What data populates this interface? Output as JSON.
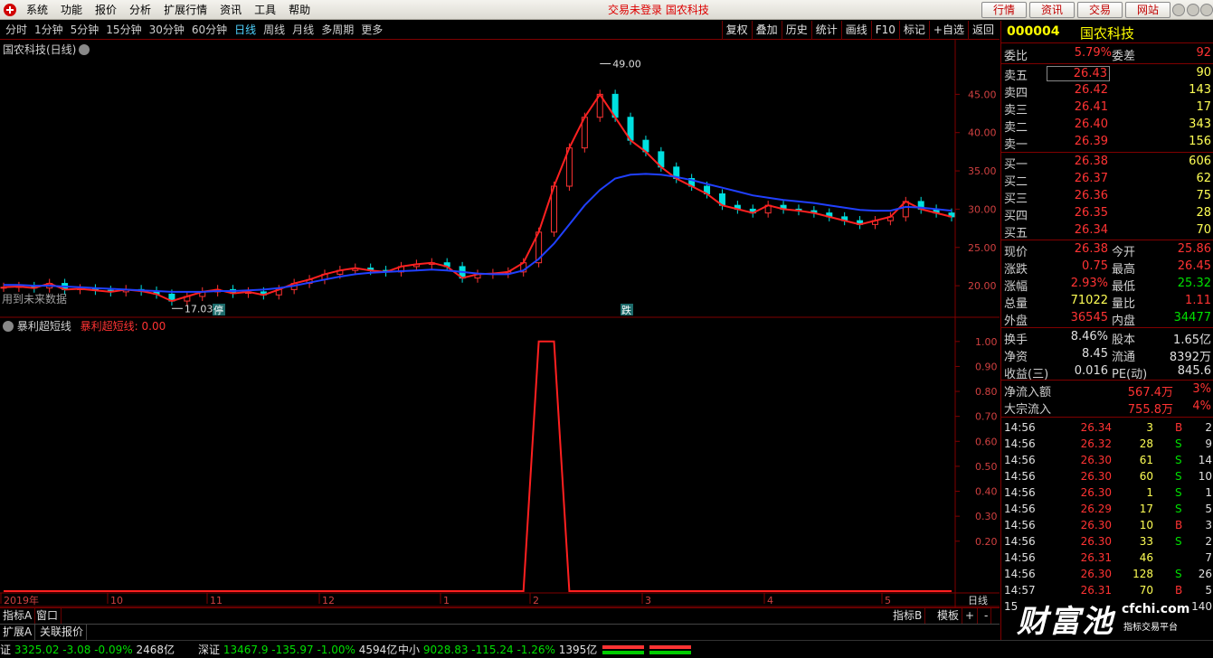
{
  "menubar": {
    "items": [
      "系统",
      "功能",
      "报价",
      "分析",
      "扩展行情",
      "资讯",
      "工具",
      "帮助"
    ],
    "status": "交易未登录  国农科技",
    "buttons": [
      "行情",
      "资讯",
      "交易",
      "网站"
    ]
  },
  "periodbar": {
    "periods": [
      "分时",
      "1分钟",
      "5分钟",
      "15分钟",
      "30分钟",
      "60分钟",
      "日线",
      "周线",
      "月线",
      "多周期",
      "更多"
    ],
    "active": "日线",
    "tools": [
      "复权",
      "叠加",
      "历史",
      "统计",
      "画线",
      "F10",
      "标记",
      "+自选",
      "返回"
    ]
  },
  "main_chart": {
    "title": "国农科技(日线)",
    "future_note": "用到未来数据",
    "high_label": "49.00",
    "low_label": "17.03",
    "marker_ting": "停",
    "marker_die": "跌"
  },
  "indicator": {
    "name": "暴利超短线",
    "value_label": "暴利超短线: 0.00"
  },
  "axis_bottom": {
    "labels": [
      "2019年",
      "10",
      "11",
      "12",
      "1",
      "2",
      "3",
      "4",
      "5"
    ],
    "period": "日线"
  },
  "tabs": {
    "row1": [
      "指标A",
      "窗口"
    ],
    "row1_right": [
      "指标B",
      "模板",
      "+",
      "-"
    ],
    "row2": [
      "扩展A",
      "关联报价"
    ]
  },
  "chart_data": [
    {
      "type": "line",
      "title": "国农科技(日线)",
      "ylim": [
        16,
        50
      ],
      "yticks": [
        "45.00",
        "40.00",
        "35.00",
        "30.00",
        "25.00",
        "20.00"
      ],
      "high": 49.0,
      "low": 17.03,
      "series": [
        {
          "values": [
            19.8,
            19.9,
            19.7,
            20.3,
            19.5,
            19.6,
            19.4,
            19.2,
            19.5,
            19.3,
            18.9,
            18.0,
            18.6,
            19.2,
            19.5,
            19.0,
            19.2,
            18.8,
            19.5,
            20.3,
            20.8,
            21.5,
            22.0,
            22.3,
            22.0,
            21.8,
            22.5,
            22.8,
            23.0,
            22.5,
            21.0,
            21.5,
            21.6,
            21.8,
            23.0,
            27.0,
            33.0,
            38.0,
            42.0,
            45.0,
            42.0,
            39.0,
            37.5,
            35.5,
            34.0,
            33.0,
            32.0,
            30.5,
            30.0,
            29.5,
            30.5,
            30.0,
            29.8,
            29.5,
            29.0,
            28.5,
            28.0,
            28.5,
            29.0,
            31.0,
            30.0,
            29.5,
            29.0
          ]
        },
        {
          "values": [
            20.1,
            20.1,
            20.0,
            20.0,
            19.9,
            19.8,
            19.7,
            19.6,
            19.5,
            19.4,
            19.3,
            19.2,
            19.2,
            19.2,
            19.3,
            19.3,
            19.4,
            19.5,
            19.7,
            20.0,
            20.4,
            20.8,
            21.2,
            21.5,
            21.7,
            21.8,
            21.9,
            22.0,
            22.1,
            22.0,
            21.8,
            21.6,
            21.5,
            21.5,
            22.0,
            23.5,
            25.5,
            28.0,
            30.5,
            32.5,
            34.0,
            34.5,
            34.6,
            34.5,
            34.2,
            33.8,
            33.3,
            32.8,
            32.3,
            31.8,
            31.5,
            31.2,
            31.0,
            30.8,
            30.5,
            30.2,
            29.9,
            29.8,
            29.8,
            30.3,
            30.2,
            30.0,
            29.8
          ]
        }
      ]
    },
    {
      "type": "line",
      "title": "暴利超短线",
      "ylim": [
        0,
        1.05
      ],
      "yticks": [
        "1.00",
        "0.90",
        "0.80",
        "0.70",
        "0.60",
        "0.50",
        "0.40",
        "0.30",
        "0.20"
      ],
      "series": [
        {
          "name": "暴利超短线",
          "values": [
            0,
            0,
            0,
            0,
            0,
            0,
            0,
            0,
            0,
            0,
            0,
            0,
            0,
            0,
            0,
            0,
            0,
            0,
            0,
            0,
            0,
            0,
            0,
            0,
            0,
            0,
            0,
            0,
            0,
            0,
            0,
            0,
            0,
            0,
            0,
            1,
            1,
            0,
            0,
            0,
            0,
            0,
            0,
            0,
            0,
            0,
            0,
            0,
            0,
            0,
            0,
            0,
            0,
            0,
            0,
            0,
            0,
            0,
            0,
            0,
            0,
            0,
            0
          ]
        }
      ]
    }
  ],
  "panel": {
    "code": "000004",
    "name": "国农科技",
    "weibi_label": "委比",
    "weibi": "5.79%",
    "weicha_label": "委差",
    "weicha": "92",
    "asks": [
      {
        "label": "卖五",
        "price": "26.43",
        "vol": "90"
      },
      {
        "label": "卖四",
        "price": "26.42",
        "vol": "143"
      },
      {
        "label": "卖三",
        "price": "26.41",
        "vol": "17"
      },
      {
        "label": "卖二",
        "price": "26.40",
        "vol": "343"
      },
      {
        "label": "卖一",
        "price": "26.39",
        "vol": "156"
      }
    ],
    "bids": [
      {
        "label": "买一",
        "price": "26.38",
        "vol": "606"
      },
      {
        "label": "买二",
        "price": "26.37",
        "vol": "62"
      },
      {
        "label": "买三",
        "price": "26.36",
        "vol": "75"
      },
      {
        "label": "买四",
        "price": "26.35",
        "vol": "28"
      },
      {
        "label": "买五",
        "price": "26.34",
        "vol": "70"
      }
    ],
    "quote": [
      {
        "l1": "现价",
        "v1": "26.38",
        "l2": "今开",
        "v2": "25.86"
      },
      {
        "l1": "涨跌",
        "v1": "0.75",
        "l2": "最高",
        "v2": "26.45"
      },
      {
        "l1": "涨幅",
        "v1": "2.93%",
        "l2": "最低",
        "v2": "25.32"
      },
      {
        "l1": "总量",
        "v1": "71022",
        "l2": "量比",
        "v2": "1.11"
      },
      {
        "l1": "外盘",
        "v1": "36545",
        "l2": "内盘",
        "v2": "34477"
      }
    ],
    "fund": [
      {
        "l1": "换手",
        "v1": "8.46%",
        "l2": "股本",
        "v2": "1.65亿"
      },
      {
        "l1": "净资",
        "v1": "8.45",
        "l2": "流通",
        "v2": "8392万"
      },
      {
        "l1": "收益(三)",
        "v1": "0.016",
        "l2": "PE(动)",
        "v2": "845.6"
      }
    ],
    "flow": [
      {
        "label": "净流入额",
        "value": "567.4万",
        "pct": "3%"
      },
      {
        "label": "大宗流入",
        "value": "755.8万",
        "pct": "4%"
      }
    ],
    "ticks": [
      {
        "time": "14:56",
        "price": "26.34",
        "vol": "3",
        "bs": "B",
        "n": "2"
      },
      {
        "time": "14:56",
        "price": "26.32",
        "vol": "28",
        "bs": "S",
        "n": "9"
      },
      {
        "time": "14:56",
        "price": "26.30",
        "vol": "61",
        "bs": "S",
        "n": "14"
      },
      {
        "time": "14:56",
        "price": "26.30",
        "vol": "60",
        "bs": "S",
        "n": "10"
      },
      {
        "time": "14:56",
        "price": "26.30",
        "vol": "1",
        "bs": "S",
        "n": "1"
      },
      {
        "time": "14:56",
        "price": "26.29",
        "vol": "17",
        "bs": "S",
        "n": "5"
      },
      {
        "time": "14:56",
        "price": "26.30",
        "vol": "10",
        "bs": "B",
        "n": "3"
      },
      {
        "time": "14:56",
        "price": "26.30",
        "vol": "33",
        "bs": "S",
        "n": "2"
      },
      {
        "time": "14:56",
        "price": "26.31",
        "vol": "46",
        "bs": "",
        "n": "7"
      },
      {
        "time": "14:56",
        "price": "26.30",
        "vol": "128",
        "bs": "S",
        "n": "26"
      },
      {
        "time": "14:57",
        "price": "26.31",
        "vol": "70",
        "bs": "B",
        "n": "5"
      }
    ],
    "last_tick_partial": "15",
    "last_tick_n": "140"
  },
  "statusbar": {
    "sh": {
      "name": "证",
      "idx": "3325.02",
      "chg": "-3.08",
      "pct": "-0.09%",
      "amt": "2468亿"
    },
    "sz": {
      "name": "深证",
      "idx": "13467.9",
      "chg": "-135.97",
      "pct": "-1.00%",
      "amt": "4594亿"
    },
    "zx": {
      "name": "中小",
      "idx": "9028.83",
      "chg": "-115.24",
      "pct": "-1.26%",
      "amt": "1395亿"
    }
  },
  "watermark": {
    "big": "财富池",
    "domain": "cfchi.com",
    "sub": "指标交易平台"
  },
  "colors": {
    "up": "#ff3333",
    "down": "#00e0e0",
    "ma1": "#ff2020",
    "ma2": "#2040ff",
    "frame": "#800000"
  }
}
